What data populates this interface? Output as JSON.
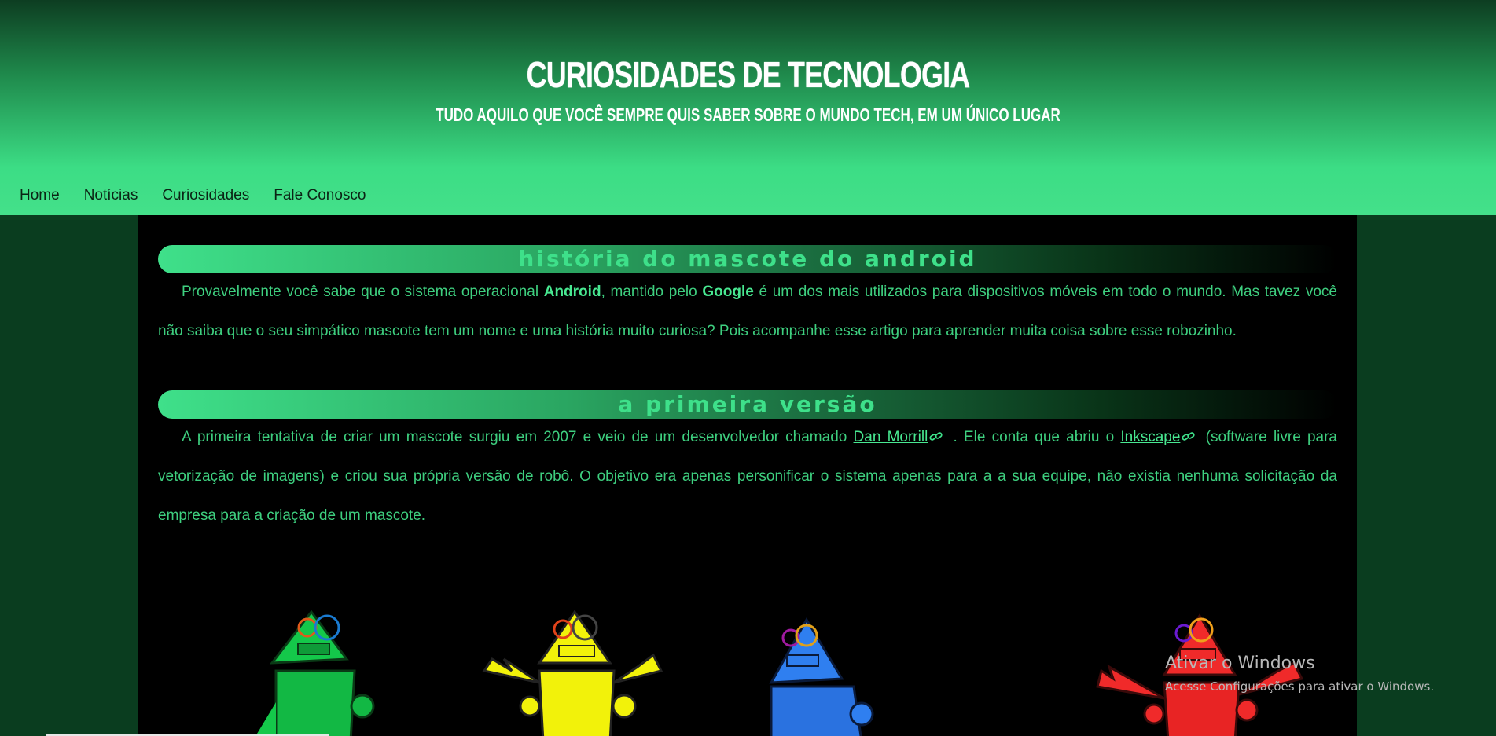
{
  "header": {
    "title": "CURIOSIDADES DE TECNOLOGIA",
    "subtitle": "TUDO AQUILO QUE VOCÊ SEMPRE QUIS SABER SOBRE O MUNDO TECH, EM UM ÚNICO LUGAR"
  },
  "nav": {
    "items": [
      {
        "label": "Home"
      },
      {
        "label": "Notícias"
      },
      {
        "label": "Curiosidades"
      },
      {
        "label": "Fale Conosco"
      }
    ]
  },
  "article": {
    "heading1": "História do mascote do Android",
    "para1": {
      "t1": "Provavelmente você sabe que o sistema operacional ",
      "b1": "Android",
      "t2": ", mantido pelo ",
      "b2": "Google",
      "t3": " é um dos mais utilizados para dispositivos móveis em todo o mundo. Mas tavez você não saiba que o seu simpático mascote tem um nome e uma história muito curiosa? Pois acompanhe esse artigo para aprender muita coisa sobre esse robozinho."
    },
    "heading2": "A primeira versão",
    "para2": {
      "t1": "A primeira tentativa de criar um mascote surgiu em 2007 e veio de um desenvolvedor chamado ",
      "link1": "Dan Morrill",
      "t2": " . Ele conta que abriu o ",
      "link2": "Inkscape",
      "t3": " (software livre para vetorização de imagens) e criou sua própria versão de robô. O objetivo era apenas personificar o sistema apenas para a a sua equipe, não existia nenhuma solicitação da empresa para a criação de um mascote."
    }
  },
  "robots": [
    {
      "name": "green-robot",
      "color": "#14c84a"
    },
    {
      "name": "yellow-robot",
      "color": "#f2f20a"
    },
    {
      "name": "blue-robot",
      "color": "#2f7ff0"
    },
    {
      "name": "red-robot",
      "color": "#f02a2a"
    }
  ],
  "windows_watermark": {
    "title": "Ativar o Windows",
    "subtitle": "Acesse Configurações para ativar o Windows."
  },
  "colors": {
    "accent": "#3ee08a",
    "background": "#000000",
    "side": "#0a3d1f"
  }
}
